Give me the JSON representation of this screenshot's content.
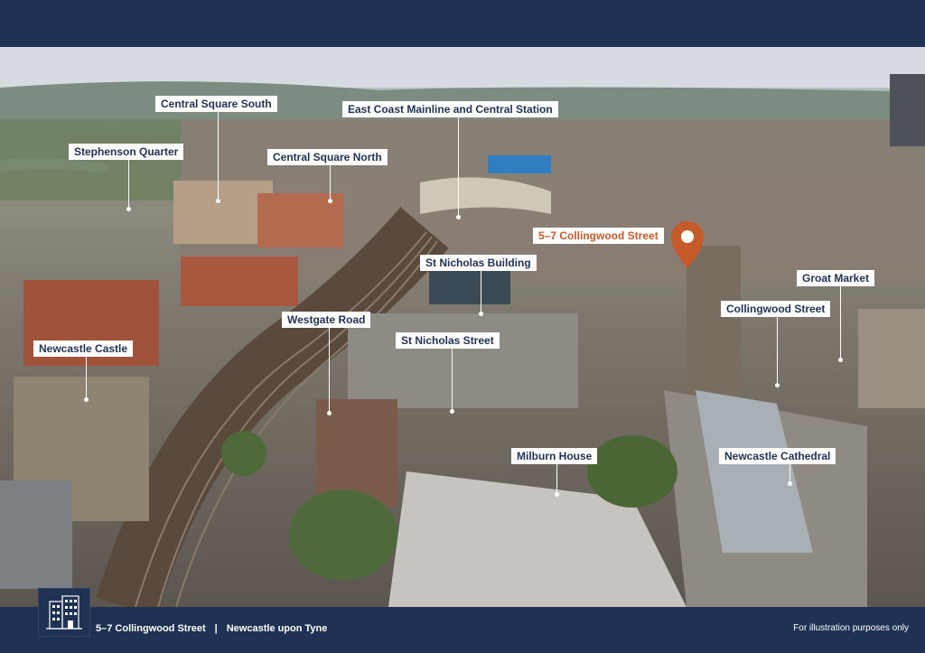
{
  "labels": {
    "central_square_south": "Central Square South",
    "east_coast_mainline": "East Coast Mainline and Central Station",
    "stephenson_quarter": "Stephenson Quarter",
    "central_square_north": "Central Square North",
    "collingwood_street_pin": "5–7 Collingwood Street",
    "st_nicholas_building": "St Nicholas Building",
    "groat_market": "Groat Market",
    "westgate_road": "Westgate Road",
    "collingwood_street": "Collingwood Street",
    "newcastle_castle": "Newcastle Castle",
    "st_nicholas_street": "St Nicholas Street",
    "milburn_house": "Milburn House",
    "newcastle_cathedral": "Newcastle Cathedral"
  },
  "footer": {
    "street": "5–7 Collingwood Street",
    "separator": "|",
    "city": "Newcastle upon Tyne",
    "disclaimer": "For illustration purposes only"
  },
  "colors": {
    "navy": "#1f3253",
    "accent": "#c55a2b",
    "label_bg": "#ffffff"
  },
  "icons": {
    "location_pin": "location-pin-icon",
    "building_logo": "building-icon"
  }
}
